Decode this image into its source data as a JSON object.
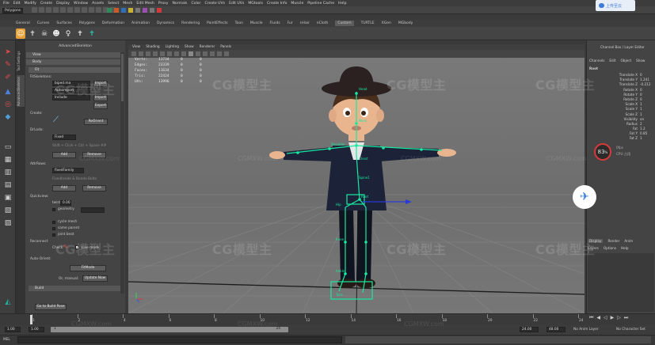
{
  "menubar": {
    "items": [
      "File",
      "Edit",
      "Modify",
      "Create",
      "Display",
      "Window",
      "Assets",
      "Select",
      "Mesh",
      "Edit Mesh",
      "Proxy",
      "Normals",
      "Color",
      "Create UVs",
      "Edit UVs",
      "MGtools",
      "Create Info",
      "Muscle",
      "Pipeline Cache",
      "Help"
    ]
  },
  "status_line": {
    "mode": "Polygons"
  },
  "cloud_button": {
    "label": "上传至云"
  },
  "shelf": {
    "tabs": [
      "General",
      "Curves",
      "Surfaces",
      "Polygons",
      "Deformation",
      "Animation",
      "Dynamics",
      "Rendering",
      "PaintEffects",
      "Toon",
      "Muscle",
      "Fluids",
      "Fur",
      "nHair",
      "nCloth",
      "Custom",
      "TURTLE",
      "XGen",
      "MGbody"
    ],
    "active_tab": "Custom"
  },
  "toolbox": {
    "side_tabs": [
      "Tool Settings",
      "AdvancedSkeleton"
    ]
  },
  "as_panel": {
    "title": "AdvancedSkeleton",
    "sections": {
      "view": "View",
      "body": "Body",
      "fit": "Fit",
      "build": "Build"
    },
    "fit_skeleton_label": "FitSkeletons:",
    "fit_buttons": [
      "Import",
      "Delete",
      "Import",
      "Export"
    ],
    "fit_rows": [
      "biped.ma",
      "Autoimport",
      "Include"
    ],
    "create_label": "Create:",
    "reorient_button": "ReOrient",
    "dd_label": "DrLodo:",
    "field_fixed": "Fixed",
    "hint_text": "Shift + Click + Ctrl + Space ##",
    "add_button": "Add",
    "remove_button": "Remove",
    "attr_label": "AttrRows:",
    "field_attr": "fixedFamily",
    "hint_attr": "FixedInside & Bonde Bolto",
    "add_button_2": "Add",
    "remove_button_2": "Remove",
    "quickview_label": "Quickview:",
    "twist_label": "twist",
    "twist_value": "0.00",
    "checkbox_rows": [
      "geometry",
      "cycle mesh",
      "same parent",
      "joint beat"
    ],
    "symmetry_label": "Reconnect",
    "check_label": "Check",
    "live_mode": "Live mode",
    "auto_orient_label": "Auto-Orient:",
    "fitmode_button": "FitMode",
    "or_manual": "Or, manual:",
    "update_now": "Update Now",
    "go_to_build": "Go to Build Pose"
  },
  "viewport": {
    "menu": [
      "View",
      "Shading",
      "Lighting",
      "Show",
      "Renderer",
      "Panels"
    ],
    "hud": [
      {
        "label": "Verts:",
        "a": "11734",
        "b": "0",
        "c": "0"
      },
      {
        "label": "Edges:",
        "a": "23339",
        "b": "0",
        "c": "0"
      },
      {
        "label": "Faces:",
        "a": "11634",
        "b": "0",
        "c": "0"
      },
      {
        "label": "Tris:",
        "a": "22424",
        "b": "0",
        "c": "0"
      },
      {
        "label": "UVs:",
        "a": "13996",
        "b": "0",
        "c": "0"
      }
    ],
    "joint_labels": [
      "Head",
      "Neck",
      "Chest",
      "Shoulder",
      "Spine1",
      "Root",
      "Hip",
      "Knee",
      "Ankle",
      "Toes"
    ]
  },
  "channel_box": {
    "tabs": [
      "Channels",
      "Edit",
      "Object",
      "Show"
    ],
    "object": "Root",
    "title": "Channel Box / Layer Editor",
    "channels": [
      {
        "name": "Translate X",
        "value": "0"
      },
      {
        "name": "Translate Y",
        "value": "1.241"
      },
      {
        "name": "Translate Z",
        "value": "-0.212"
      },
      {
        "name": "Rotate X",
        "value": "0"
      },
      {
        "name": "Rotate Y",
        "value": "0"
      },
      {
        "name": "Rotate Z",
        "value": "0"
      },
      {
        "name": "Scale X",
        "value": "1"
      },
      {
        "name": "Scale Y",
        "value": "1"
      },
      {
        "name": "Scale Z",
        "value": "1"
      },
      {
        "name": "Visibility",
        "value": "on"
      },
      {
        "name": "Radius",
        "value": "2"
      },
      {
        "name": "Fat",
        "value": "1.2"
      },
      {
        "name": "Fat Y",
        "value": "0.85"
      },
      {
        "name": "Fat Z",
        "value": "1"
      }
    ],
    "perf_value": "83",
    "perf_unit": "%",
    "perf_stats": [
      "0fps",
      "CPU 占用"
    ],
    "layer_tabs": [
      "Display",
      "Render",
      "Anim"
    ],
    "layer_menu": [
      "Layers",
      "Options",
      "Help"
    ]
  },
  "time_slider": {
    "ticks": [
      "1",
      "2",
      "4",
      "6",
      "8",
      "10",
      "12",
      "14",
      "16",
      "18",
      "20",
      "22",
      "24"
    ],
    "current": "1"
  },
  "range_slider": {
    "start": "1.00",
    "inner_start": "1.00",
    "mid": "1",
    "range_end_label": "24",
    "end": "24.00",
    "max": "48.00",
    "anim_layer": "No Anim Layer",
    "char_set": "No Character Set"
  },
  "command_line": {
    "lang": "MEL"
  },
  "watermarks": {
    "brand": "CG模型主",
    "url": "CGMXW.com"
  },
  "colors": {
    "bg_dark": "#3a3a3a",
    "viewport_grey": "#747474",
    "joint_green": "#19e8a0",
    "jacket_navy": "#1c2338",
    "skin": "#e9b58f",
    "hat": "#2b2120"
  }
}
